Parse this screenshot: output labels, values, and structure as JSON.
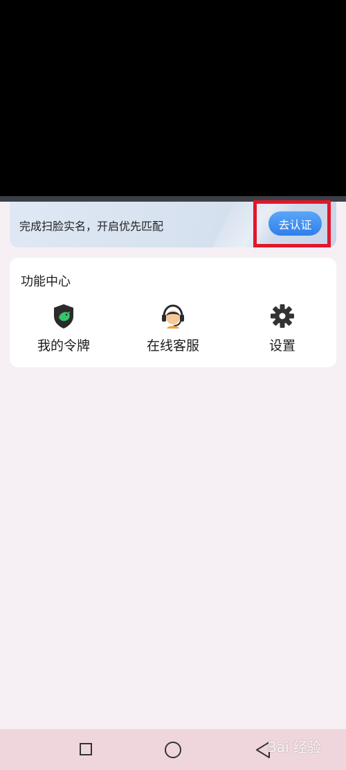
{
  "banner": {
    "text": "完成扫脸实名，开启优先匹配",
    "button_label": "去认证"
  },
  "function_center": {
    "title": "功能中心",
    "items": [
      {
        "label": "我的令牌",
        "icon": "shield-token-icon"
      },
      {
        "label": "在线客服",
        "icon": "customer-service-icon"
      },
      {
        "label": "设置",
        "icon": "gear-icon"
      }
    ]
  },
  "nav_bar": {
    "icons": [
      "recent-apps-icon",
      "home-icon",
      "back-icon"
    ]
  },
  "watermark": {
    "text": "Bai 经验"
  },
  "colors": {
    "accent": "#2f7fe9",
    "highlight": "#e3162a",
    "nav_background": "#efd6dd"
  }
}
